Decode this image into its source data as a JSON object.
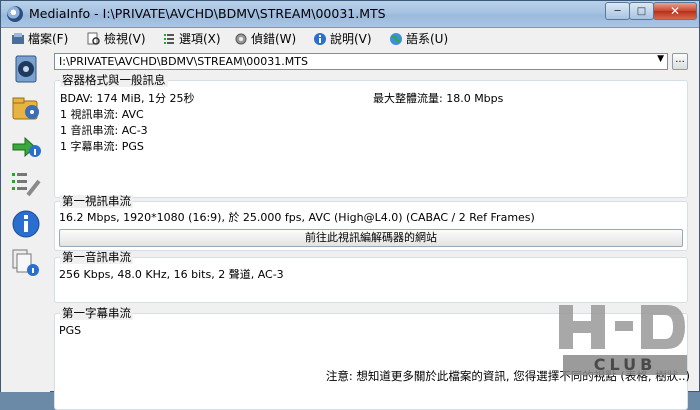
{
  "window": {
    "title": "MediaInfo - I:\\PRIVATE\\AVCHD\\BDMV\\STREAM\\00031.MTS",
    "controls": {
      "minimize": "─",
      "maximize": "□",
      "close": "✕"
    }
  },
  "menu": {
    "items": [
      {
        "label": "檔案(F)",
        "icon": "file-icon"
      },
      {
        "label": "檢視(V)",
        "icon": "view-icon"
      },
      {
        "label": "選項(X)",
        "icon": "options-icon"
      },
      {
        "label": "偵錯(W)",
        "icon": "debug-icon"
      },
      {
        "label": "說明(V)",
        "icon": "help-icon"
      },
      {
        "label": "語系(U)",
        "icon": "language-icon"
      }
    ]
  },
  "sidebar": {
    "items": [
      "open-file-icon",
      "open-folder-icon",
      "export-icon",
      "options-icon",
      "about-info-icon",
      "knowledge-icon"
    ]
  },
  "file_selector": {
    "value": "I:\\PRIVATE\\AVCHD\\BDMV\\STREAM\\00031.MTS",
    "more_label": "..."
  },
  "general": {
    "title": "容器格式與一般訊息",
    "lines": [
      "BDAV: 174 MiB, 1分 25秒",
      "1 視訊串流: AVC",
      "1 音訊串流: AC-3",
      "1 字幕串流: PGS"
    ],
    "bitrate": "最大整體流量: 18.0 Mbps"
  },
  "video": {
    "title": "第一視訊串流",
    "line": "16.2 Mbps, 1920*1080 (16:9), 於 25.000 fps, AVC (High@L4.0) (CABAC / 2 Ref Frames)",
    "web_button": "前往此視訊編解碼器的網站"
  },
  "audio": {
    "title": "第一音訊串流",
    "line": "256 Kbps, 48.0 KHz, 16 bits, 2 聲道, AC-3"
  },
  "subtitle": {
    "title": "第一字幕串流",
    "line": "PGS"
  },
  "footer": {
    "note": "注意: 想知道更多關於此檔案的資訊, 您得選擇不同的視點 (表格, 樹狀..)"
  },
  "watermark": {
    "text": "HD CLUB"
  },
  "colors": {
    "titlebar": "#a6c2e2",
    "close": "#c8452b",
    "panel": "#ffffff"
  }
}
